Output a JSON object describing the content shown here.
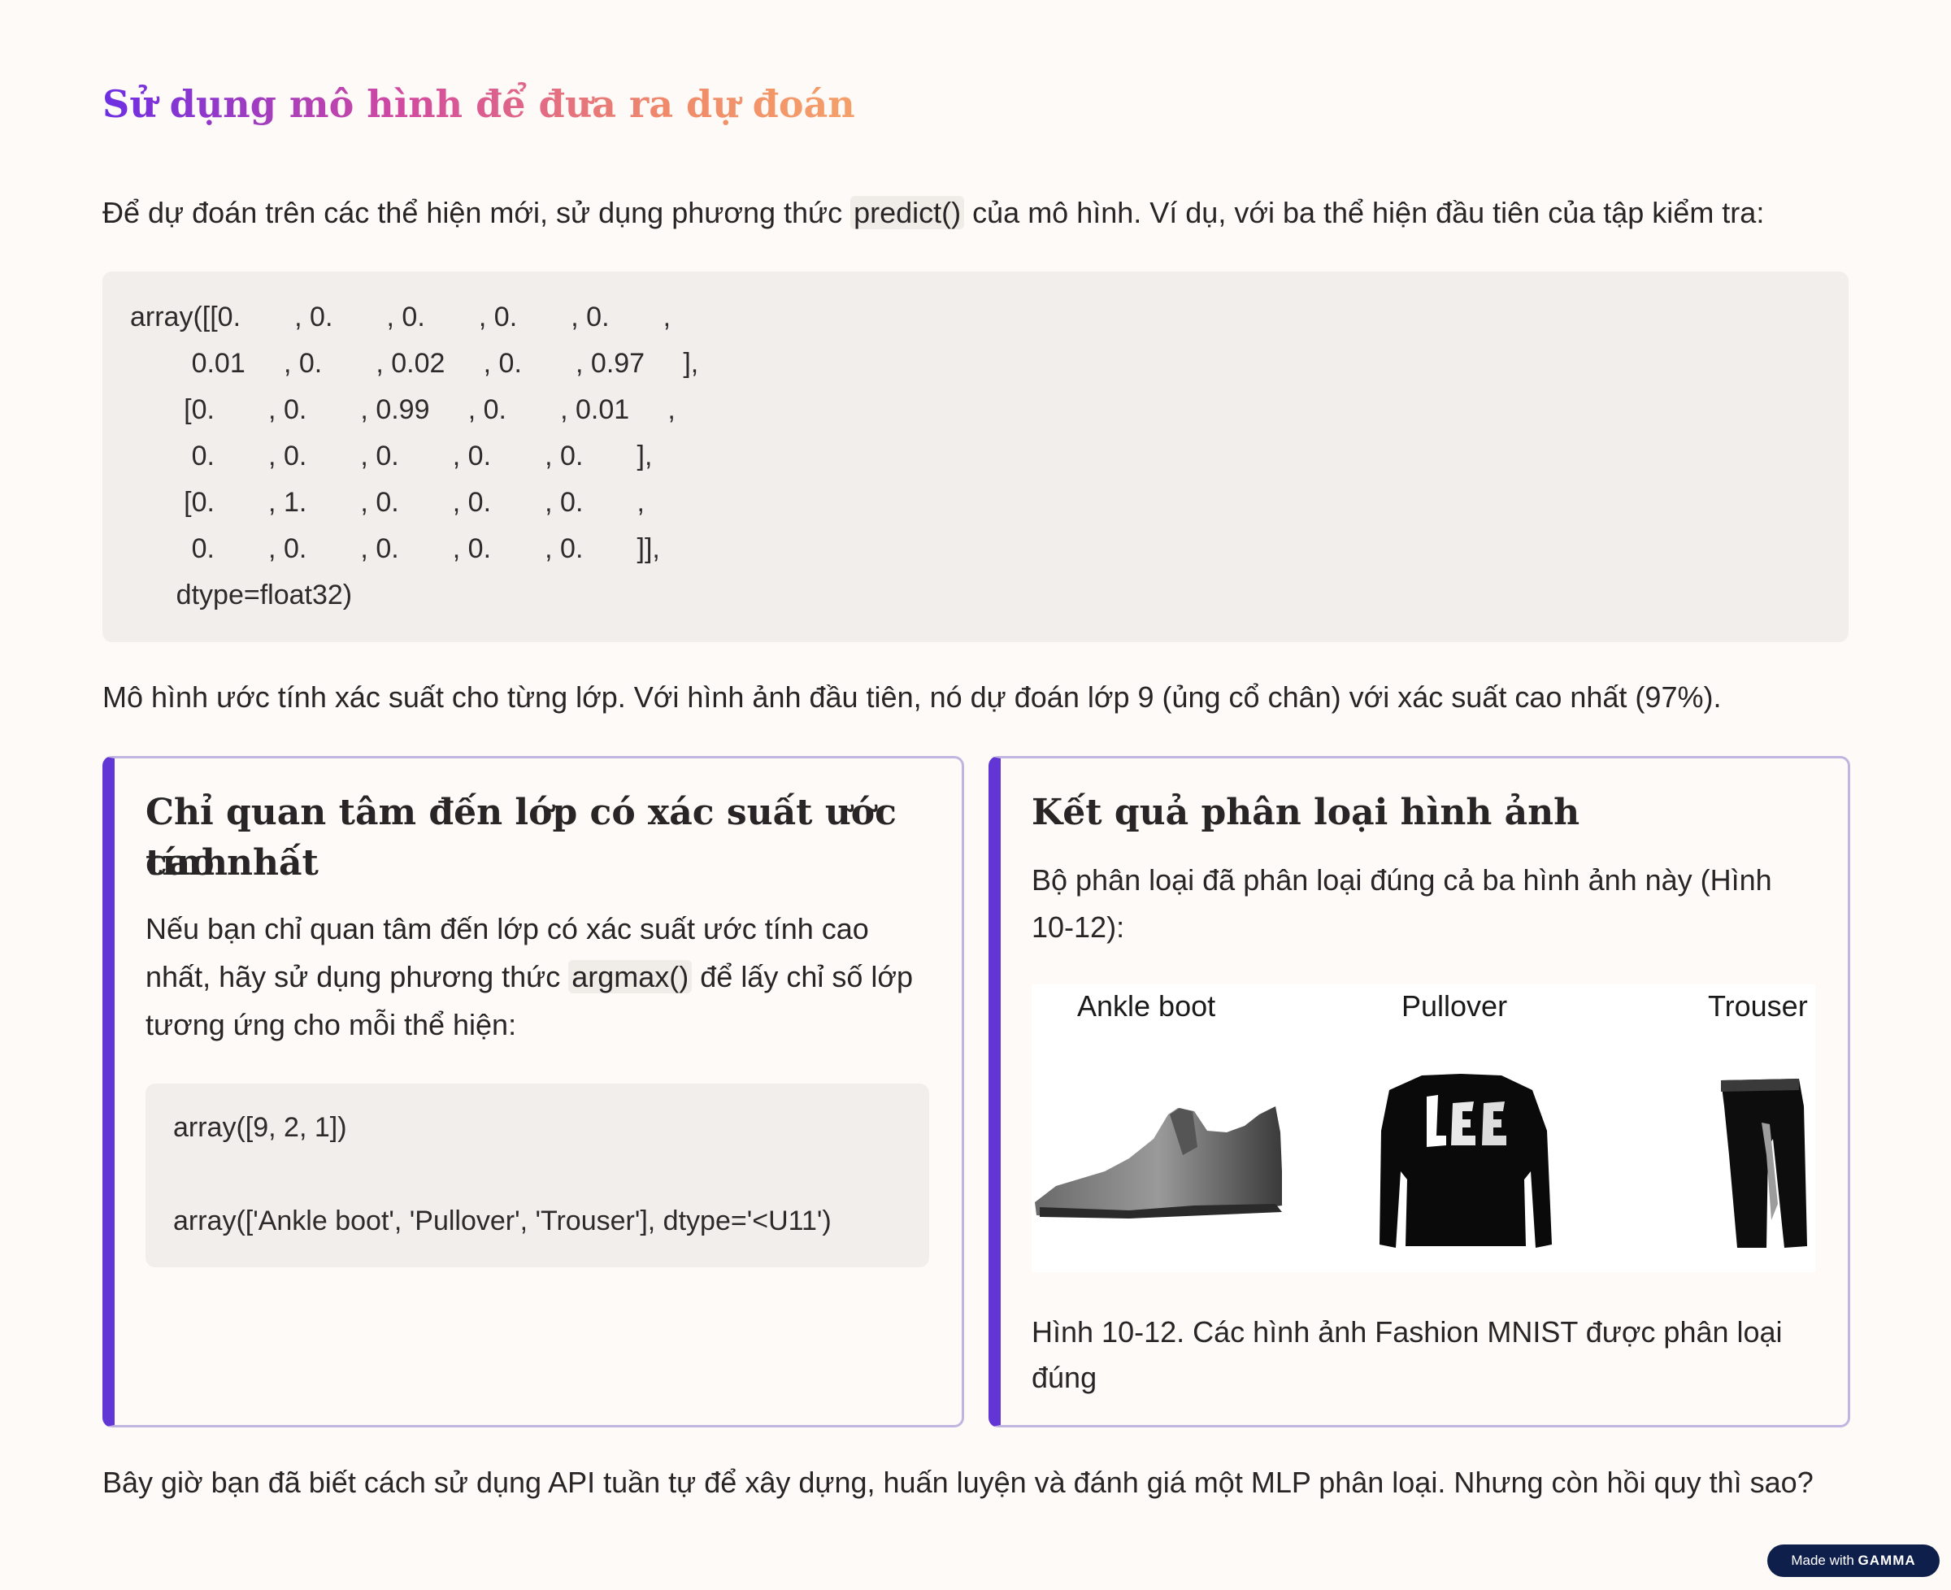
{
  "heading": "Sử dụng mô hình để đưa ra dự đoán",
  "intro": {
    "before": "Để dự đoán trên các thể hiện mới, sử dụng phương thức ",
    "code": "predict()",
    "after": " của mô hình. Ví dụ, với ba thể hiện đầu tiên của tập kiểm tra:"
  },
  "code_output": [
    "array([[0.       , 0.       , 0.       , 0.       , 0.       ,",
    "        0.01     , 0.       , 0.02     , 0.       , 0.97     ],",
    "       [0.       , 0.       , 0.99     , 0.       , 0.01     ,",
    "        0.       , 0.       , 0.       , 0.       , 0.       ],",
    "       [0.       , 1.       , 0.       , 0.       , 0.       ,",
    "        0.       , 0.       , 0.       , 0.       , 0.       ]],",
    "      dtype=float32)"
  ],
  "explanation": "Mô hình ước tính xác suất cho từng lớp. Với hình ảnh đầu tiên, nó dự đoán lớp 9 (ủng cổ chân) với xác suất cao nhất (97%).",
  "card_left": {
    "title_line1": "Chỉ quan tâm đến lớp có xác suất ước tính",
    "title_line2": "cao nhất",
    "body_line1": "Nếu bạn chỉ quan tâm đến lớp có xác suất ước tính cao",
    "body_line2_before": "nhất, hãy sử dụng phương thức ",
    "body_line2_code": "argmax()",
    "body_line2_after": " để lấy chỉ số lớp",
    "body_line3": "tương ứng cho mỗi thể hiện:",
    "code_line1": "array([9, 2, 1])",
    "code_line2": "array(['Ankle boot', 'Pullover', 'Trouser'], dtype='<U11')"
  },
  "card_right": {
    "title": "Kết quả phân loại hình ảnh",
    "body_line1": "Bộ phân loại đã phân loại đúng cả ba hình ảnh này (Hình",
    "body_line2": "10-12):",
    "figure_labels": [
      "Ankle boot",
      "Pullover",
      "Trouser"
    ],
    "caption_line1": "Hình 10-12. Các hình ảnh Fashion MNIST được phân loại",
    "caption_line2": "đúng"
  },
  "closing": "Bây giờ bạn đã biết cách sử dụng API tuần tự để xây dựng, huấn luyện và đánh giá một MLP phân loại. Nhưng còn hồi quy thì sao?",
  "badge": {
    "prefix": "Made with ",
    "brand": "GAMMA"
  },
  "colors": {
    "accent": "#6236d4",
    "card_border": "#bfb5e0",
    "code_bg": "#f1eeeb",
    "page_bg": "#fdfaf7"
  }
}
